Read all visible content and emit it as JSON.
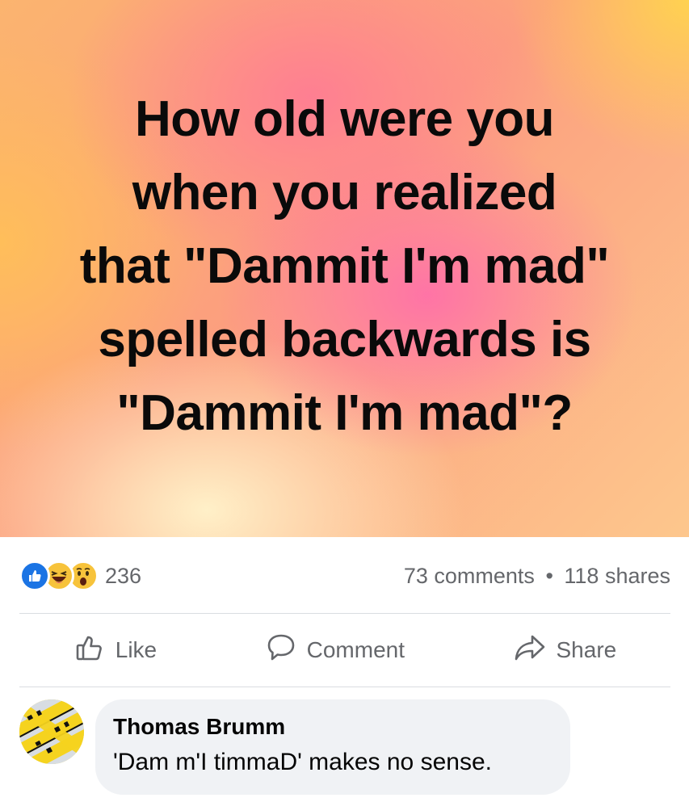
{
  "post": {
    "text": "How old were you\nwhen you realized\nthat \"Dammit I'm mad\"\nspelled backwards is\n\"Dammit I'm mad\"?"
  },
  "stats": {
    "reactions": [
      "like-icon",
      "haha-icon",
      "wow-icon"
    ],
    "reaction_count": "236",
    "comments": "73 comments",
    "separator": "•",
    "shares": "118 shares"
  },
  "actions": {
    "like_label": "Like",
    "comment_label": "Comment",
    "share_label": "Share"
  },
  "comment": {
    "author": "Thomas Brumm",
    "text": "'Dam m'I timmaD' makes no sense."
  },
  "colors": {
    "accent": "#1b74e4",
    "secondary_text": "#65676b",
    "bubble_bg": "#f0f2f5"
  }
}
